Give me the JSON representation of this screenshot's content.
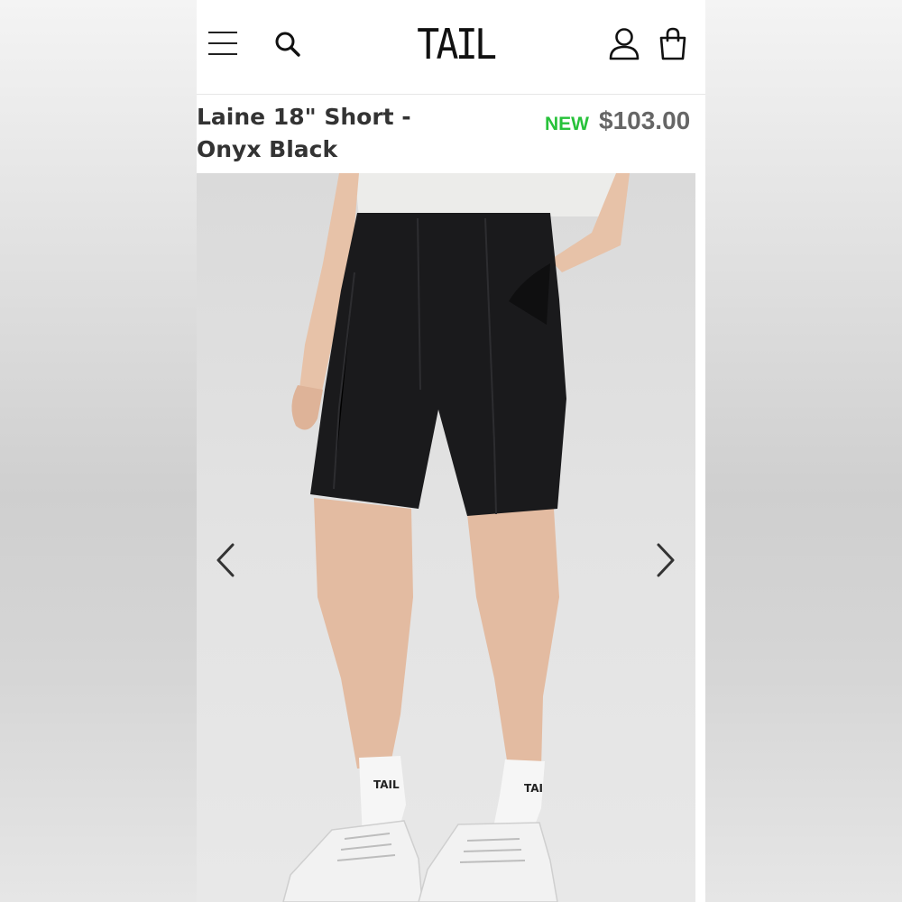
{
  "header": {
    "brand": "TAIL",
    "menu_icon": "hamburger-menu-icon",
    "search_icon": "search-icon",
    "account_icon": "user-icon",
    "bag_icon": "shopping-bag-icon"
  },
  "product": {
    "title_line1": "Laine 18\" Short -",
    "title_line2": "Onyx Black",
    "badge": "NEW",
    "price": "$103.00",
    "sock_logo": "TAIL",
    "sock_logo_right": "TAI"
  },
  "carousel": {
    "prev_icon": "chevron-left-icon",
    "next_icon": "chevron-right-icon"
  },
  "colors": {
    "badge": "#27c23a",
    "price": "#666666",
    "title": "#333333",
    "short": "#1a1a1c"
  }
}
